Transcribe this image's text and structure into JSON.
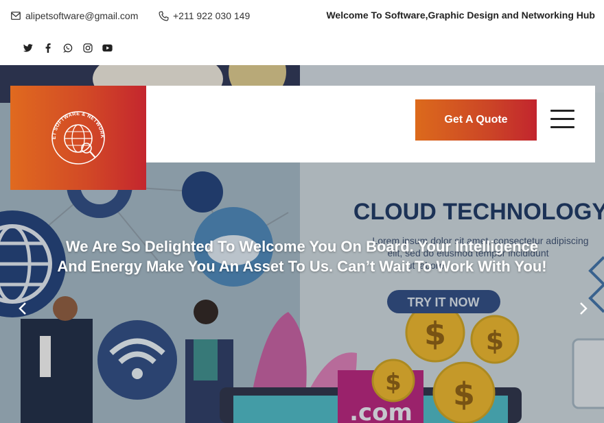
{
  "topbar": {
    "email": "alipetsoftware@gmail.com",
    "phone": "+211 922 030 149",
    "welcome": "Welcome To Software,Graphic Design and Networking Hub",
    "socials": [
      {
        "icon": "twitter-icon"
      },
      {
        "icon": "facebook-icon"
      },
      {
        "icon": "whatsapp-icon"
      },
      {
        "icon": "instagram-icon"
      },
      {
        "icon": "youtube-icon"
      }
    ]
  },
  "header": {
    "logo_text": "ALIPET SOFTWARE & NETWORK HUB",
    "quote_label": "Get A Quote",
    "menu_icon": "hamburger-menu-icon"
  },
  "hero": {
    "headline_line1": "We Are So Delighted To Welcome You On Board. Your Intelligence",
    "headline_line2": "And Energy Make You An Asset To Us. Can’t Wait To Work With You!",
    "bg_title": "CLOUD TECHNOLOGY",
    "bg_lorem_1": "Lorem ipsum dolor sit amet, consectetur adipiscing",
    "bg_lorem_2": "elit, sed do eiusmod tempor incididunt",
    "bg_lorem_3": "ut labore",
    "bg_button": "TRY IT NOW",
    "bg_domain": ".com",
    "prev_icon": "chevron-left-icon",
    "next_icon": "chevron-right-icon"
  },
  "colors": {
    "brand_gradient_start": "#e06a1f",
    "brand_gradient_end": "#c4262e",
    "cloud_title": "#1a3561"
  }
}
